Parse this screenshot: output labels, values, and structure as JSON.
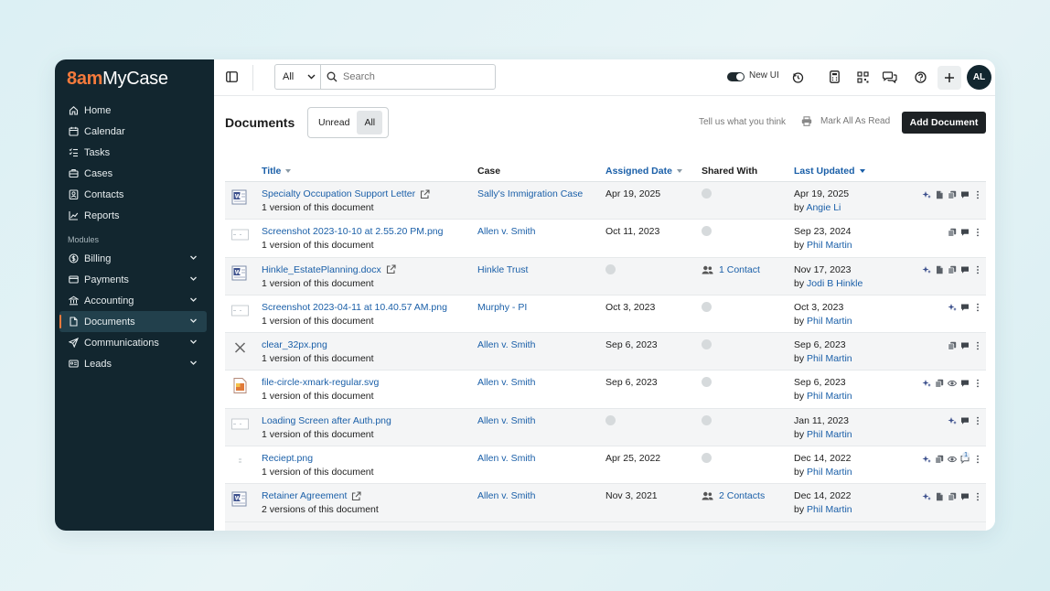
{
  "app": {
    "logo_prefix": "8am",
    "logo_suffix": "MyCase"
  },
  "sidebar": {
    "items": [
      {
        "label": "Home",
        "icon": "home-icon"
      },
      {
        "label": "Calendar",
        "icon": "calendar-icon"
      },
      {
        "label": "Tasks",
        "icon": "tasks-icon"
      },
      {
        "label": "Cases",
        "icon": "briefcase-icon"
      },
      {
        "label": "Contacts",
        "icon": "contacts-icon"
      },
      {
        "label": "Reports",
        "icon": "chart-icon"
      }
    ],
    "modules_heading": "Modules",
    "modules": [
      {
        "label": "Billing",
        "icon": "dollar-icon"
      },
      {
        "label": "Payments",
        "icon": "card-icon"
      },
      {
        "label": "Accounting",
        "icon": "bank-icon"
      },
      {
        "label": "Documents",
        "icon": "file-icon",
        "active": true
      },
      {
        "label": "Communications",
        "icon": "send-icon"
      },
      {
        "label": "Leads",
        "icon": "id-card-icon"
      }
    ]
  },
  "topbar": {
    "search_scope": "All",
    "search_placeholder": "Search",
    "new_ui_label": "New UI",
    "avatar_initials": "AL"
  },
  "page": {
    "title": "Documents",
    "filter_unread": "Unread",
    "filter_all": "All",
    "feedback_link": "Tell us what you think",
    "mark_all_read": "Mark All As Read",
    "add_document": "Add Document"
  },
  "table": {
    "headers": {
      "title": "Title",
      "case": "Case",
      "assigned_date": "Assigned Date",
      "shared_with": "Shared With",
      "last_updated": "Last Updated"
    },
    "rows": [
      {
        "title": "Specialty Occupation Support Letter",
        "external": true,
        "versions": "1 version of this document",
        "case": "Sally's Immigration Case",
        "assigned": "Apr 19, 2025",
        "shared": "",
        "updated": "Apr 19, 2025",
        "by_prefix": "by",
        "by": "Angie Li",
        "icon": "word-doc"
      },
      {
        "title": "Screenshot 2023-10-10 at 2.55.20 PM.png",
        "external": false,
        "versions": "1 version of this document",
        "case": "Allen v. Smith",
        "assigned": "Oct 11, 2023",
        "shared": "",
        "updated": "Sep 23, 2024",
        "by_prefix": "by",
        "by": "Phil Martin",
        "icon": "image-thumb"
      },
      {
        "title": "Hinkle_EstatePlanning.docx",
        "external": true,
        "versions": "1 version of this document",
        "case": "Hinkle Trust",
        "assigned": "",
        "shared": "1 Contact",
        "updated": "Nov 17, 2023",
        "by_prefix": "by",
        "by": "Jodi B Hinkle",
        "icon": "word-doc"
      },
      {
        "title": "Screenshot 2023-04-11 at 10.40.57 AM.png",
        "external": false,
        "versions": "1 version of this document",
        "case": "Murphy - PI",
        "assigned": "Oct 3, 2023",
        "shared": "",
        "updated": "Oct 3, 2023",
        "by_prefix": "by",
        "by": "Phil Martin",
        "icon": "image-thumb"
      },
      {
        "title": "clear_32px.png",
        "external": false,
        "versions": "1 version of this document",
        "case": "Allen v. Smith",
        "assigned": "Sep 6, 2023",
        "shared": "",
        "updated": "Sep 6, 2023",
        "by_prefix": "by",
        "by": "Phil Martin",
        "icon": "x-thumb"
      },
      {
        "title": "file-circle-xmark-regular.svg",
        "external": false,
        "versions": "1 version of this document",
        "case": "Allen v. Smith",
        "assigned": "Sep 6, 2023",
        "shared": "",
        "updated": "Sep 6, 2023",
        "by_prefix": "by",
        "by": "Phil Martin",
        "icon": "svg-thumb"
      },
      {
        "title": "Loading Screen after Auth.png",
        "external": false,
        "versions": "1 version of this document",
        "case": "Allen v. Smith",
        "assigned": "",
        "shared": "",
        "updated": "Jan 11, 2023",
        "by_prefix": "by",
        "by": "Phil Martin",
        "icon": "image-thumb"
      },
      {
        "title": "Reciept.png",
        "external": false,
        "versions": "1 version of this document",
        "case": "Allen v. Smith",
        "assigned": "Apr 25, 2022",
        "shared": "",
        "updated": "Dec 14, 2022",
        "by_prefix": "by",
        "by": "Phil Martin",
        "icon": "receipt-thumb",
        "comment_count": "1"
      },
      {
        "title": "Retainer Agreement",
        "external": true,
        "versions": "2 versions of this document",
        "case": "Allen v. Smith",
        "assigned": "Nov 3, 2021",
        "shared": "2 Contacts",
        "updated": "Dec 14, 2022",
        "by_prefix": "by",
        "by": "Phil Martin",
        "icon": "word-doc"
      }
    ]
  },
  "colors": {
    "sidebar_bg": "#12262f",
    "accent": "#f47a3c",
    "link": "#1a5fa8",
    "primary_button": "#1d2124"
  }
}
